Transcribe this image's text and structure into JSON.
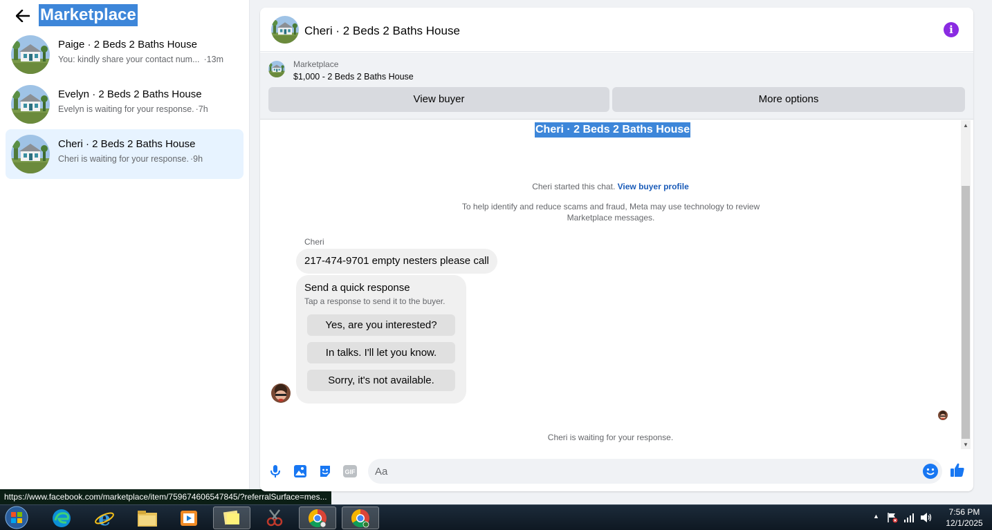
{
  "left_pane": {
    "title": "Marketplace",
    "conversations": [
      {
        "name": "Paige · 2 Beds 2 Baths House",
        "preview": "You: kindly share your contact num...",
        "time": "·13m",
        "active": false
      },
      {
        "name": "Evelyn · 2 Beds 2 Baths House",
        "preview": "Evelyn is waiting for your response.",
        "time": "·7h",
        "active": false
      },
      {
        "name": "Cheri · 2 Beds 2 Baths House",
        "preview": "Cheri is waiting for your response.",
        "time": "·9h",
        "active": true
      }
    ]
  },
  "status_url": "https://www.facebook.com/marketplace/item/759674606547845/?referralSurface=mes...",
  "chat": {
    "title": "Cheri · 2 Beds 2 Baths House",
    "listing": {
      "source": "Marketplace",
      "price_title": "$1,000 - 2 Beds 2 Baths House",
      "view_buyer_label": "View buyer",
      "more_options_label": "More options"
    },
    "conversation_heading": "Cheri · 2 Beds 2 Baths House",
    "started_text": "Cheri started this chat.",
    "view_profile_link": "View buyer profile",
    "scam_notice": "To help identify and reduce scams and fraud, Meta may use technology to review Marketplace messages.",
    "sender_name": "Cheri",
    "message": "217-474-9701 empty nesters please call",
    "quick_response": {
      "title": "Send a quick response",
      "subtitle": "Tap a response to send it to the buyer.",
      "options": [
        "Yes, are you interested?",
        "In talks. I'll let you know.",
        "Sorry, it's not available."
      ]
    },
    "waiting_text": "Cheri is waiting for your response.",
    "composer": {
      "placeholder": "Aa",
      "gif_label": "GIF"
    }
  },
  "taskbar": {
    "time": "7:56 PM",
    "date": "12/1/2025"
  },
  "colors": {
    "accent": "#1877f2",
    "selection": "#3d86d9",
    "info": "#8a2be2",
    "active_conversation": "#e7f3ff"
  }
}
